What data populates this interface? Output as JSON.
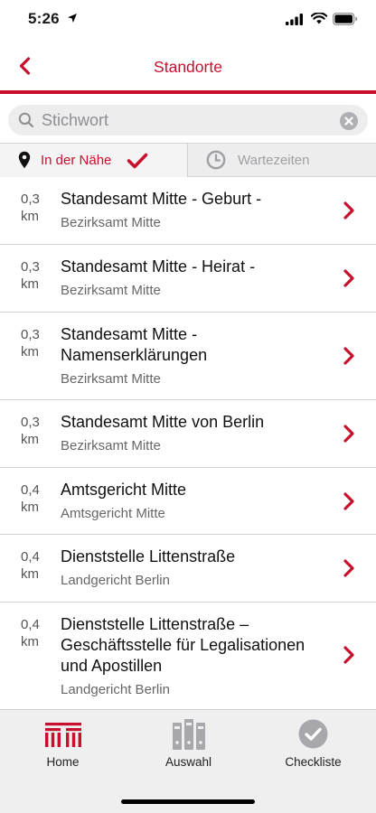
{
  "status_bar": {
    "time": "5:26"
  },
  "nav": {
    "title": "Standorte"
  },
  "search": {
    "placeholder": "Stichwort",
    "value": ""
  },
  "segments": {
    "near_label": "In der Nähe",
    "wait_label": "Wartezeiten",
    "active": "near"
  },
  "locations": [
    {
      "distance": "0,3 km",
      "title": "Standesamt Mitte - Geburt -",
      "subtitle": "Bezirksamt Mitte"
    },
    {
      "distance": "0,3 km",
      "title": "Standesamt Mitte - Heirat -",
      "subtitle": "Bezirksamt Mitte"
    },
    {
      "distance": "0,3 km",
      "title": "Standesamt Mitte - Namenserklärungen",
      "subtitle": "Bezirksamt Mitte"
    },
    {
      "distance": "0,3 km",
      "title": "Standesamt Mitte von Berlin",
      "subtitle": "Bezirksamt Mitte"
    },
    {
      "distance": "0,4 km",
      "title": "Amtsgericht Mitte",
      "subtitle": "Amtsgericht Mitte"
    },
    {
      "distance": "0,4 km",
      "title": "Dienststelle Littenstraße",
      "subtitle": "Landgericht Berlin"
    },
    {
      "distance": "0,4 km",
      "title": "Dienststelle Littenstraße – Geschäftsstelle für Legalisationen und Apostillen",
      "subtitle": "Landgericht Berlin"
    }
  ],
  "tabbar": {
    "home": "Home",
    "selection": "Auswahl",
    "checklist": "Checkliste"
  },
  "colors": {
    "accent": "#c8102e",
    "inactive": "#a0a0a4"
  }
}
